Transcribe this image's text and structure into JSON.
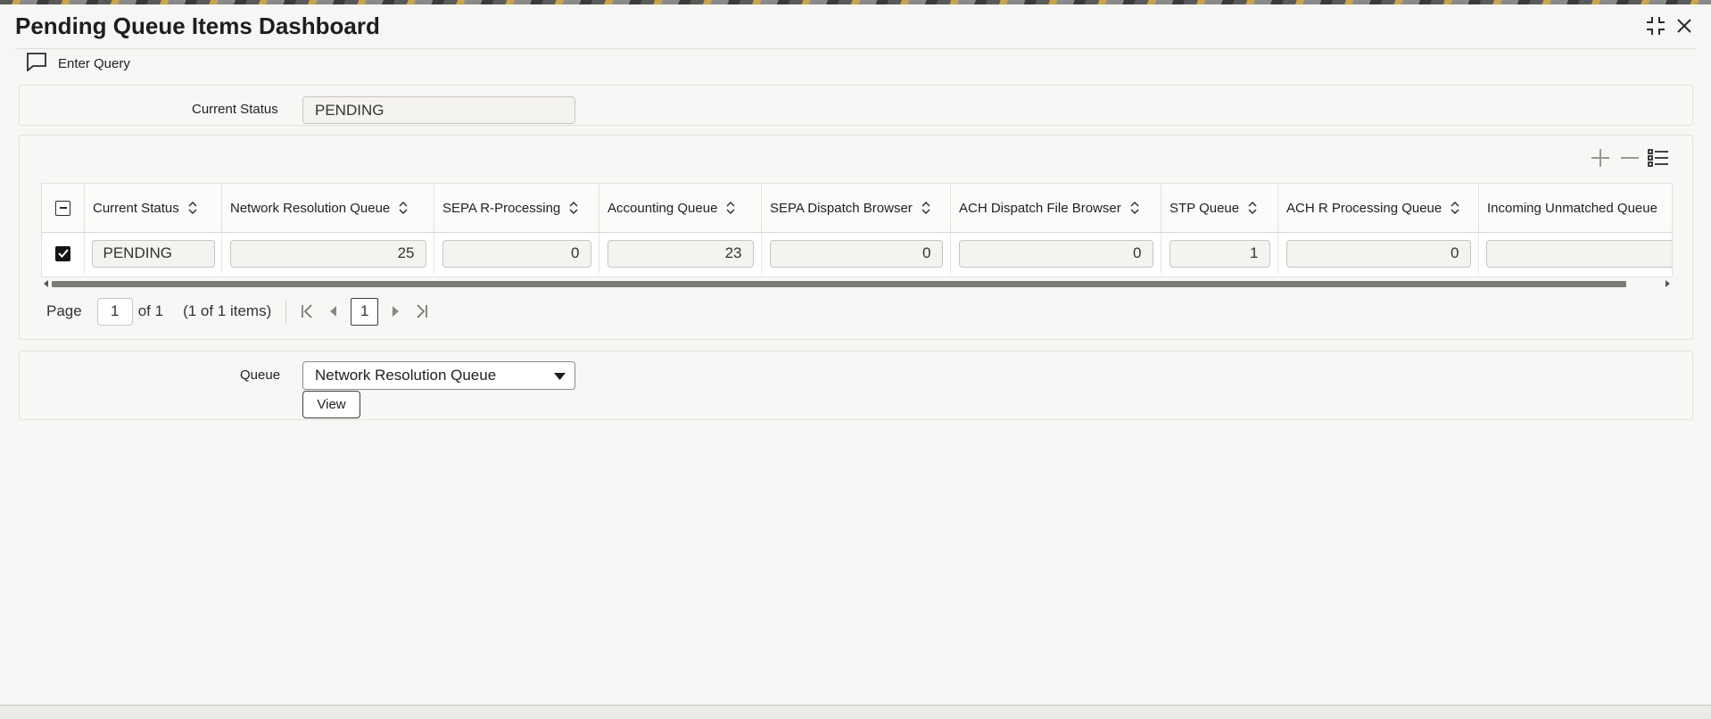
{
  "page": {
    "title": "Pending Queue Items Dashboard"
  },
  "window": {
    "collapse_icon": "compress-icon",
    "close_icon": "close-icon"
  },
  "toolbar": {
    "enter_query_label": "Enter Query",
    "enter_query_icon": "chat-bubble-icon"
  },
  "status_panel": {
    "label": "Current Status",
    "value": "PENDING"
  },
  "grid_tools": {
    "add_icon": "plus-icon",
    "remove_icon": "minus-icon",
    "columns_icon": "list-settings-icon"
  },
  "grid": {
    "columns": [
      "Current Status",
      "Network Resolution Queue",
      "SEPA R-Processing",
      "Accounting Queue",
      "SEPA Dispatch Browser",
      "ACH Dispatch File Browser",
      "STP Queue",
      "ACH R Processing Queue",
      "Incoming Unmatched Queue"
    ],
    "rows": [
      {
        "checked": true,
        "cells": [
          "PENDING",
          "25",
          "0",
          "23",
          "0",
          "0",
          "1",
          "0",
          ""
        ]
      }
    ]
  },
  "pagination": {
    "page_label": "Page",
    "page_value": "1",
    "of_label": "of 1",
    "items_label": "(1 of 1 items)",
    "current_page": "1"
  },
  "queue_panel": {
    "label": "Queue",
    "selected": "Network Resolution Queue",
    "view_label": "View"
  },
  "colors": {
    "accent_border": "#3d3d3d",
    "scroll_thumb": "#7c7b78",
    "panel_bg": "#f8f7f5"
  }
}
